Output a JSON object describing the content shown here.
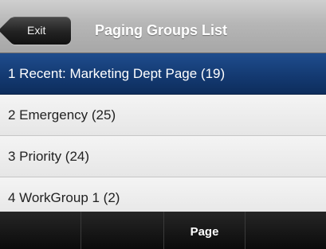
{
  "header": {
    "exit_label": "Exit",
    "title": "Paging Groups List"
  },
  "list": {
    "items": [
      {
        "label": "1 Recent: Marketing Dept Page (19)",
        "selected": true
      },
      {
        "label": "2 Emergency (25)",
        "selected": false
      },
      {
        "label": "3 Priority (24)",
        "selected": false
      },
      {
        "label": "4 WorkGroup 1 (2)",
        "selected": false
      }
    ]
  },
  "softkeys": [
    "",
    "",
    "Page",
    ""
  ],
  "colors": {
    "selection": "#143a72",
    "header": "#b6b6b6",
    "softkey_bar": "#111111"
  }
}
